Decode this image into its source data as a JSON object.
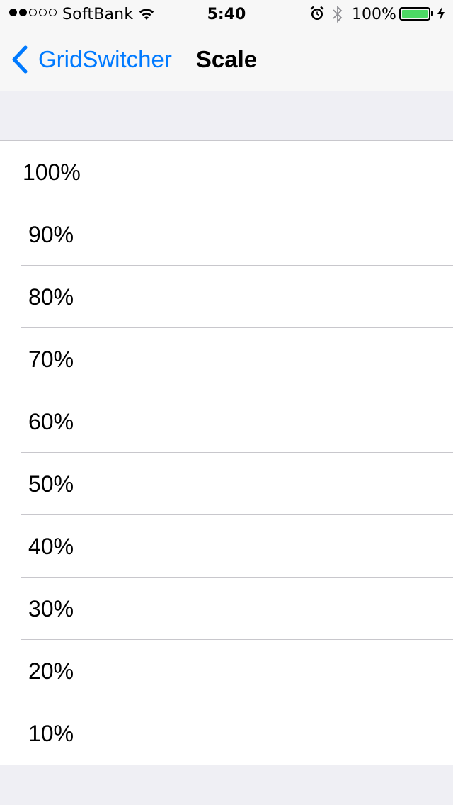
{
  "status_bar": {
    "signal_bars": 5,
    "signal_filled": 2,
    "carrier": "SoftBank",
    "time": "5:40",
    "battery_percent_text": "100%",
    "battery_level": 1.0,
    "icons": [
      "wifi-icon",
      "alarm-icon",
      "bluetooth-icon",
      "battery-icon",
      "charging-icon"
    ]
  },
  "nav": {
    "back_label": "GridSwitcher",
    "title": "Scale"
  },
  "options": [
    {
      "label": "100%"
    },
    {
      "label": "90%"
    },
    {
      "label": "80%"
    },
    {
      "label": "70%"
    },
    {
      "label": "60%"
    },
    {
      "label": "50%"
    },
    {
      "label": "40%"
    },
    {
      "label": "30%"
    },
    {
      "label": "20%"
    },
    {
      "label": "10%"
    }
  ],
  "colors": {
    "accent": "#007aff",
    "battery": "#4cd964",
    "background": "#efeff4",
    "separator": "#c8c7cc"
  }
}
